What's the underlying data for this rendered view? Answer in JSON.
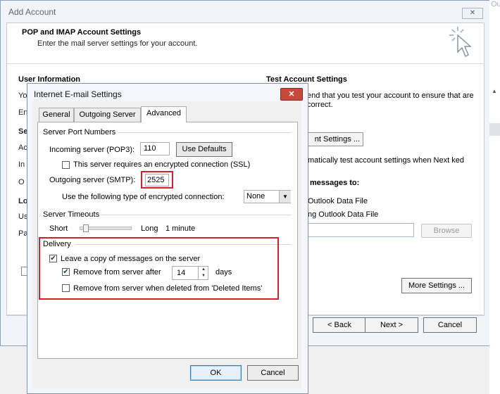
{
  "background_window": {
    "title": "Add Account",
    "close_glyph": "✕",
    "header_title": "POP and IMAP Account Settings",
    "header_subtitle": "Enter the mail server settings for your account.",
    "user_information_label": "User Information",
    "left_column_letters": [
      "Yo",
      "En",
      "Se",
      "Ac",
      "In",
      "O",
      "Lo",
      "Us",
      "Pa"
    ],
    "test_account_settings_label": "Test Account Settings",
    "test_description": "end that you test your account to ensure that are correct.",
    "test_button_label": "nt Settings ...",
    "auto_test_text": "matically test account settings when Next ked",
    "deliver_messages_label": "messages to:",
    "new_data_file_label": "Outlook Data File",
    "existing_data_file_label": "ng Outlook Data File",
    "browse_label": "Browse",
    "more_settings_label": "More Settings ...",
    "back_label": "< Back",
    "next_label": "Next >",
    "cancel_label": "Cancel",
    "right_edge_text": "Ou"
  },
  "dialog": {
    "title": "Internet E-mail Settings",
    "close_glyph": "✕",
    "tabs": [
      {
        "label": "General",
        "active": false
      },
      {
        "label": "Outgoing Server",
        "active": false
      },
      {
        "label": "Advanced",
        "active": true
      }
    ],
    "server_port_numbers_label": "Server Port Numbers",
    "incoming_server_label": "Incoming server (POP3):",
    "incoming_server_value": "110",
    "use_defaults_label": "Use Defaults",
    "ssl_label": "This server requires an encrypted connection (SSL)",
    "ssl_checked": false,
    "outgoing_server_label": "Outgoing server (SMTP):",
    "outgoing_server_value": "2525",
    "encryption_label": "Use the following type of encrypted connection:",
    "encryption_value": "None",
    "server_timeouts_label": "Server Timeouts",
    "timeout_short_label": "Short",
    "timeout_long_label": "Long",
    "timeout_value": "1 minute",
    "timeout_level": 0.05,
    "delivery_label": "Delivery",
    "leave_copy_label": "Leave a copy of messages on the server",
    "leave_copy_checked": true,
    "remove_after_label": "Remove from server after",
    "remove_after_checked": true,
    "remove_after_days": "14",
    "days_label": "days",
    "remove_deleted_label": "Remove from server when deleted from 'Deleted Items'",
    "remove_deleted_checked": false,
    "ok_label": "OK",
    "cancel_label": "Cancel"
  },
  "colors": {
    "highlight_border": "#d3212c",
    "dialog_close_bg": "#c7493b",
    "window_border": "#7f95b0"
  },
  "icons": {
    "wizard": "sparkle-cursor-icon",
    "close": "close-icon",
    "dropdown": "chevron-down-icon",
    "spin_up": "spin-up-icon",
    "spin_down": "spin-down-icon"
  }
}
